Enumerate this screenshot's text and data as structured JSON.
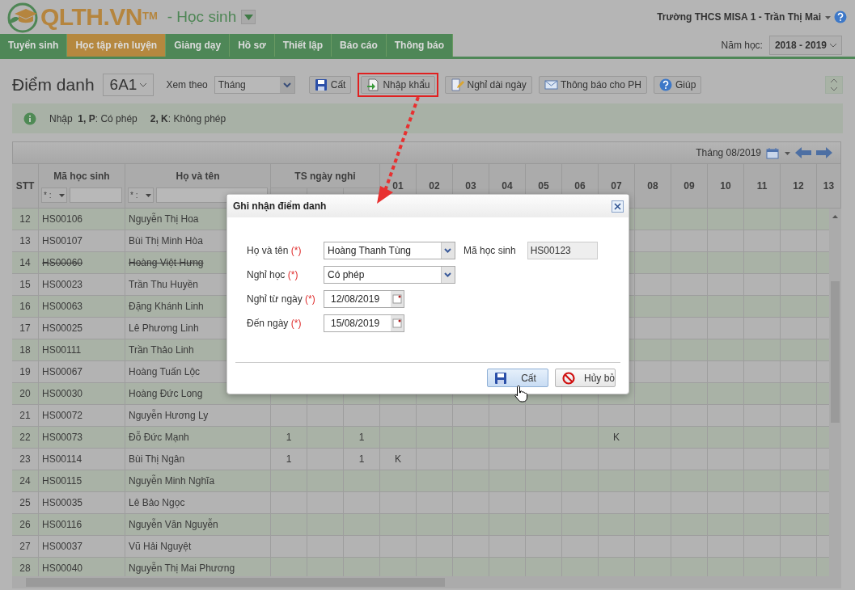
{
  "header": {
    "logo": "QLTH.VN",
    "trademark": "TM",
    "module": "- Học sinh",
    "user": "Trường THCS MISA 1 - Trần Thị Mai"
  },
  "nav": {
    "tabs": [
      {
        "label": "Tuyển sinh",
        "selected": false
      },
      {
        "label": "Học tập rèn luyện",
        "selected": true
      },
      {
        "label": "Giảng dạy",
        "selected": false
      },
      {
        "label": "Hồ sơ",
        "selected": false
      },
      {
        "label": "Thiết lập",
        "selected": false
      },
      {
        "label": "Báo cáo",
        "selected": false
      },
      {
        "label": "Thông báo",
        "selected": false
      }
    ],
    "year_label": "Năm học:",
    "year": "2018 - 2019"
  },
  "toolbar": {
    "title": "Điểm danh",
    "class": "6A1",
    "view_label": "Xem theo",
    "view": "Tháng",
    "buttons": [
      {
        "label": "Cất",
        "kind": "save",
        "highlighted": false
      },
      {
        "label": "Nhập khẩu",
        "kind": "import",
        "highlighted": true
      },
      {
        "label": "Nghỉ dài ngày",
        "kind": "leave",
        "highlighted": false
      },
      {
        "label": "Thông báo cho PH",
        "kind": "mail",
        "highlighted": false
      },
      {
        "label": "Giúp",
        "kind": "help",
        "highlighted": false
      }
    ]
  },
  "info": {
    "parts": [
      "Nhập  **1, P**: Có phép",
      "**2, K**: Không phép"
    ]
  },
  "grid": {
    "period": "Tháng 08/2019",
    "columns": {
      "stt": "STT",
      "code": "Mã học sinh",
      "name": "Họ và tên",
      "ts_group": "TS ngày nghỉ",
      "days": [
        "01",
        "02",
        "03",
        "04",
        "05",
        "06",
        "07",
        "08",
        "09",
        "10",
        "11",
        "12",
        "13"
      ]
    },
    "filters": [
      {
        "operator": "* :"
      },
      {
        "operator": "* :"
      }
    ],
    "rows": [
      {
        "stt": "12",
        "code": "HS00106",
        "name": "Nguyễn Thị Hoa",
        "struck": false,
        "shaded": true
      },
      {
        "stt": "13",
        "code": "HS00107",
        "name": "Bùi Thị Minh Hòa",
        "struck": false,
        "shaded": false
      },
      {
        "stt": "14",
        "code": "HS00060",
        "name": "Hoàng Việt Hưng",
        "struck": true,
        "shaded": true
      },
      {
        "stt": "15",
        "code": "HS00023",
        "name": "Trần Thu Huyền",
        "struck": false,
        "shaded": false
      },
      {
        "stt": "16",
        "code": "HS00063",
        "name": "Đặng Khánh Linh",
        "struck": false,
        "shaded": true
      },
      {
        "stt": "17",
        "code": "HS00025",
        "name": "Lê Phương Linh",
        "struck": false,
        "shaded": false
      },
      {
        "stt": "18",
        "code": "HS00111",
        "name": "Trần Thảo Linh",
        "struck": false,
        "shaded": true
      },
      {
        "stt": "19",
        "code": "HS00067",
        "name": "Hoàng Tuấn Lộc",
        "struck": false,
        "shaded": false
      },
      {
        "stt": "20",
        "code": "HS00030",
        "name": "Hoàng Đức Long",
        "struck": false,
        "shaded": true
      },
      {
        "stt": "21",
        "code": "HS00072",
        "name": "Nguyễn Hương Ly",
        "struck": false,
        "shaded": false
      },
      {
        "stt": "22",
        "code": "HS00073",
        "name": "Đỗ Đức Mạnh",
        "struck": false,
        "shaded": true,
        "values": {
          "ts": "1",
          "k": "1",
          "d07": "K"
        }
      },
      {
        "stt": "23",
        "code": "HS00114",
        "name": "Bùi Thị Ngân",
        "struck": false,
        "shaded": false,
        "values": {
          "ts": "1",
          "k": "1",
          "d01": "K"
        }
      },
      {
        "stt": "24",
        "code": "HS00115",
        "name": "Nguyễn Minh Nghĩa",
        "struck": false,
        "shaded": true
      },
      {
        "stt": "25",
        "code": "HS00035",
        "name": "Lê Bảo Ngọc",
        "struck": false,
        "shaded": false
      },
      {
        "stt": "26",
        "code": "HS00116",
        "name": "Nguyễn Văn Nguyễn",
        "struck": false,
        "shaded": true
      },
      {
        "stt": "27",
        "code": "HS00037",
        "name": "Vũ Hải Nguyệt",
        "struck": false,
        "shaded": false
      },
      {
        "stt": "28",
        "code": "HS00040",
        "name": "Nguyễn Thị Mai Phương",
        "struck": false,
        "shaded": true
      }
    ]
  },
  "dialog": {
    "title": "Ghi nhận điểm danh",
    "rows": [
      [
        {
          "label": "Họ và tên",
          "required_mark": "(*)",
          "kind": "select",
          "value": "Hoàng Thanh Tùng"
        },
        {
          "label": "Mã học sinh",
          "kind": "readonly",
          "value": "HS00123"
        }
      ],
      [
        {
          "label": "Nghỉ học",
          "required_mark": "(*)",
          "kind": "select",
          "value": "Có phép"
        }
      ],
      [
        {
          "label": "Nghỉ từ ngày",
          "required_mark": "(*)",
          "kind": "date",
          "value": "12/08/2019"
        }
      ],
      [
        {
          "label": "Đến ngày",
          "required_mark": "(*)",
          "kind": "date",
          "value": "15/08/2019"
        }
      ]
    ],
    "buttons": [
      {
        "label": "Cất",
        "kind": "save",
        "hovered": true
      },
      {
        "label": "Hủy bỏ",
        "kind": "cancel",
        "hovered": false
      }
    ]
  }
}
